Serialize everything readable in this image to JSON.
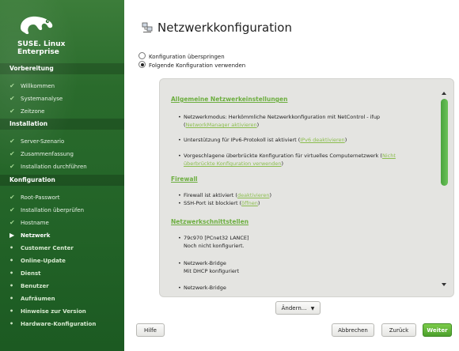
{
  "brand": {
    "line1": "SUSE. Linux",
    "line2": "Enterprise"
  },
  "sidebar": {
    "sections": [
      {
        "label": "Vorbereitung"
      },
      {
        "label": "Installation"
      },
      {
        "label": "Konfiguration"
      }
    ],
    "steps": [
      {
        "label": "Willkommen",
        "state": "done"
      },
      {
        "label": "Systemanalyse",
        "state": "done"
      },
      {
        "label": "Zeitzone",
        "state": "done"
      },
      {
        "label": "Server-Szenario",
        "state": "done"
      },
      {
        "label": "Zusammenfassung",
        "state": "done"
      },
      {
        "label": "Installation durchführen",
        "state": "done"
      },
      {
        "label": "Root-Passwort",
        "state": "done"
      },
      {
        "label": "Installation überprüfen",
        "state": "done"
      },
      {
        "label": "Hostname",
        "state": "done"
      },
      {
        "label": "Netzwerk",
        "state": "current"
      },
      {
        "label": "Customer Center",
        "state": "todo"
      },
      {
        "label": "Online-Update",
        "state": "todo"
      },
      {
        "label": "Dienst",
        "state": "todo"
      },
      {
        "label": "Benutzer",
        "state": "todo"
      },
      {
        "label": "Aufräumen",
        "state": "todo"
      },
      {
        "label": "Hinweise zur Version",
        "state": "todo"
      },
      {
        "label": "Hardware-Konfiguration",
        "state": "todo"
      }
    ]
  },
  "main": {
    "title": "Netzwerkkonfiguration",
    "radio_skip": "Konfiguration überspringen",
    "radio_use": "Folgende Konfiguration verwenden",
    "selected_radio": "use",
    "sections": {
      "general": "Allgemeine Netzwerkeinstellungen",
      "firewall": "Firewall",
      "interfaces": "Netzwerkschnittstellen"
    },
    "items": {
      "mode": "Netzwerkmodus: Herkömmliche Netzwerkkonfiguration mit NetControl - ifup",
      "mode_link": "NetworkManager aktivieren",
      "ipv6": "Unterstützung für IPv6-Protokoll ist aktiviert (",
      "ipv6_link": "IPv6 deaktivieren",
      "bridge": "Vorgeschlagene überbrückte Konfiguration für virtuelles Computernetzwerk (",
      "bridge_link": "Nicht überbrückte Konfiguration verwenden",
      "fw": "Firewall ist aktiviert (",
      "fw_link": "deaktivieren",
      "ssh": "SSH-Port ist blockiert (",
      "ssh_link": "öffnen",
      "nic1": "79c970 [PCnet32 LANCE]",
      "nic1_sub": "Noch nicht konfiguriert.",
      "nic2": "Netzwerk-Bridge",
      "nic2_sub": "Mit DHCP konfiguriert",
      "nic3": "Netzwerk-Bridge"
    },
    "close_paren": ")"
  },
  "buttons": {
    "change": "Ändern...",
    "help": "Hilfe",
    "abort": "Abbrechen",
    "back": "Zurück",
    "next": "Weiter"
  },
  "colors": {
    "accent": "#6cae3f",
    "sidebar": "#2a6b2c",
    "primary_button": "#5fb53a"
  }
}
